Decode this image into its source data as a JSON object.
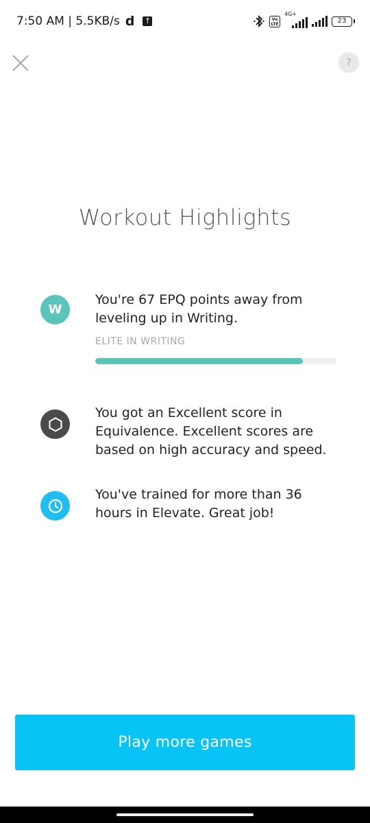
{
  "status_bar": {
    "time_speed": "7:50 AM | 5.5KB/s",
    "net_letter": "d",
    "signal_tag": "4G+",
    "volte": "Vo LTE",
    "battery": "23"
  },
  "header": {
    "help_label": "?"
  },
  "page": {
    "title": "Workout Highlights"
  },
  "highlights": [
    {
      "icon_letter": "W",
      "text": "You're 67 EPQ points away from leveling up in Writing.",
      "level_label": "ELITE IN WRITING",
      "progress_percent": 86
    },
    {
      "icon": "hexagon-icon",
      "text": "You got an Excellent score in Equivalence. Excellent scores are based on high accuracy and speed."
    },
    {
      "icon": "clock-icon",
      "text": "You've trained for more than 36 hours in Elevate. Great job!"
    }
  ],
  "cta": {
    "label": "Play more games"
  },
  "colors": {
    "teal": "#5bc5bc",
    "dark_icon": "#4a4a4a",
    "clock_blue": "#1fbef0",
    "cta_blue": "#08c3f6"
  }
}
